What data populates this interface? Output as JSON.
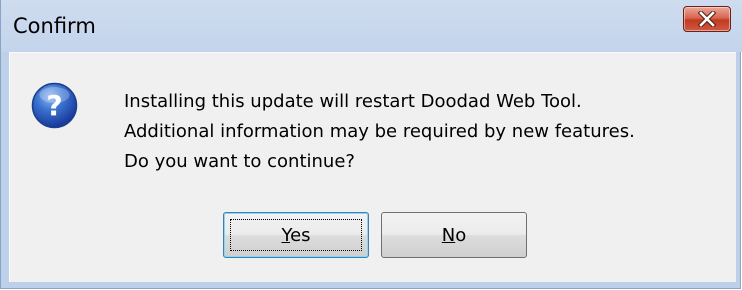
{
  "window": {
    "title": "Confirm",
    "close_icon": "close-x-icon"
  },
  "dialog": {
    "icon": "question-icon",
    "message_lines": [
      "Installing this update will restart Doodad Web Tool.",
      "Additional information may be required by new features.",
      "Do you want to continue?"
    ]
  },
  "buttons": {
    "yes": {
      "mnemonic": "Y",
      "rest": "es",
      "label": "Yes"
    },
    "no": {
      "mnemonic": "N",
      "rest": "o",
      "label": "No"
    }
  },
  "colors": {
    "close_button": "#c8452d",
    "title_bar": "#c3d4ec",
    "client_bg": "#f0f0f0",
    "question_icon": "#2a5fb8"
  }
}
